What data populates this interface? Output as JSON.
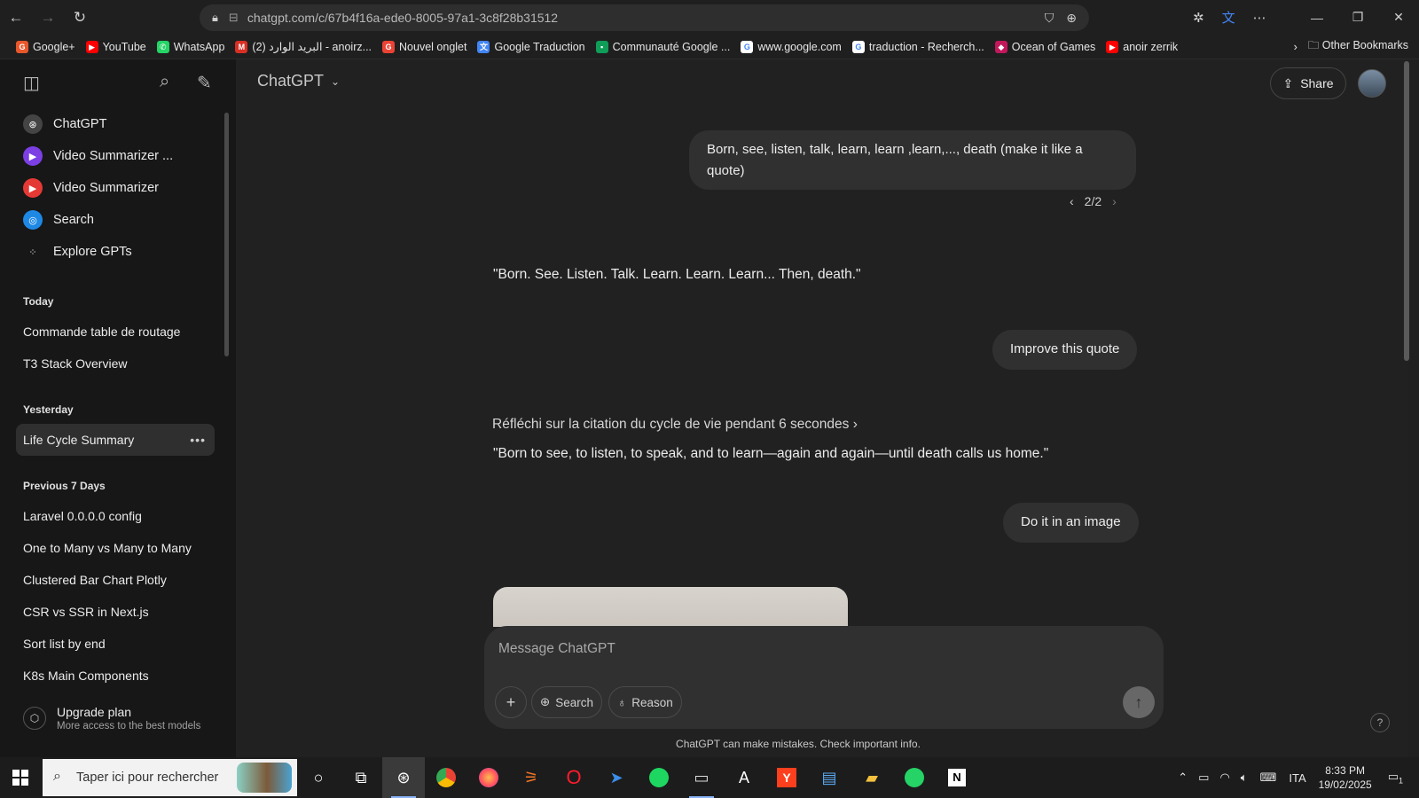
{
  "browser": {
    "url": "chatgpt.com/c/67b4f16a-ede0-8005-97a1-3c8f28b31512",
    "bookmarks": [
      {
        "label": "Google+",
        "color": "#e8572b",
        "glyph": "G"
      },
      {
        "label": "YouTube",
        "color": "#ff0000",
        "glyph": "▶"
      },
      {
        "label": "WhatsApp",
        "color": "#25d366",
        "glyph": "✆"
      },
      {
        "label": "البريد الوارد (2) - anoirz...",
        "color": "#d93025",
        "glyph": "M"
      },
      {
        "label": "Nouvel onglet",
        "color": "#ea4335",
        "glyph": "G"
      },
      {
        "label": "Google Traduction",
        "color": "#4285f4",
        "glyph": "文"
      },
      {
        "label": "Communauté Google ...",
        "color": "#0f9d58",
        "glyph": "▪"
      },
      {
        "label": "www.google.com",
        "color": "#ffffff",
        "glyph": "G"
      },
      {
        "label": "traduction - Recherch...",
        "color": "#ffffff",
        "glyph": "G"
      },
      {
        "label": "Ocean of Games",
        "color": "#c2185b",
        "glyph": "◆"
      },
      {
        "label": "anoir zerrik",
        "color": "#ff0000",
        "glyph": "▶"
      }
    ],
    "other_bookmarks": "Other Bookmarks"
  },
  "sidebar": {
    "gpts": [
      {
        "label": "ChatGPT",
        "color": "#444444",
        "glyph": "⊛"
      },
      {
        "label": "Video Summarizer ...",
        "color": "#7b3fe4",
        "glyph": "▶"
      },
      {
        "label": "Video Summarizer",
        "color": "#e53935",
        "glyph": "▶"
      },
      {
        "label": "Search",
        "color": "#1e88e5",
        "glyph": "◎"
      },
      {
        "label": "Explore GPTs",
        "color": "#171717",
        "glyph": "⁘"
      }
    ],
    "sections": [
      {
        "heading": "Today",
        "items": [
          "Commande table de routage",
          "T3 Stack Overview"
        ]
      },
      {
        "heading": "Yesterday",
        "items": [
          "Life Cycle Summary"
        ]
      },
      {
        "heading": "Previous 7 Days",
        "items": [
          "Laravel 0.0.0.0 config",
          "One to Many vs Many to Many",
          "Clustered Bar Chart Plotly",
          "CSR vs SSR in Next.js",
          "Sort list by end",
          "K8s Main Components"
        ]
      }
    ],
    "upgrade": {
      "title": "Upgrade plan",
      "subtitle": "More access to the best models"
    }
  },
  "header": {
    "model": "ChatGPT",
    "share": "Share"
  },
  "conversation": {
    "user1": "Born, see, listen, talk, learn, learn ,learn,..., death (make it like a quote)",
    "pager": "2/2",
    "assistant1": "\"Born. See. Listen. Talk. Learn. Learn. Learn... Then, death.\"",
    "user2": "Improve this quote",
    "thought": "Réfléchi sur la citation du cycle de vie pendant 6 secondes",
    "assistant2": "\"Born to see, to listen, to speak, and to learn—again and again—until death calls us home.\"",
    "user3": "Do it in an image"
  },
  "composer": {
    "placeholder": "Message ChatGPT",
    "search": "Search",
    "reason": "Reason"
  },
  "disclaimer": "ChatGPT can make mistakes. Check important info.",
  "taskbar": {
    "search_placeholder": "Taper ici pour rechercher",
    "language": "ITA",
    "time": "8:33 PM",
    "date": "19/02/2025",
    "notifications": "1"
  }
}
